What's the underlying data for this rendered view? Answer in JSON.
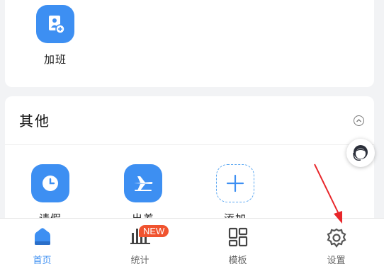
{
  "overtime": {
    "label": "加班"
  },
  "other_section": {
    "title": "其他",
    "items": [
      {
        "label": "请假",
        "icon": "clock-icon"
      },
      {
        "label": "出差",
        "icon": "airplane-icon"
      },
      {
        "label": "添加",
        "icon": "plus-icon"
      }
    ]
  },
  "tabbar": {
    "tabs": [
      {
        "label": "首页",
        "icon": "home-icon",
        "active": true
      },
      {
        "label": "统计",
        "icon": "bar-chart-icon",
        "badge": "NEW"
      },
      {
        "label": "模板",
        "icon": "grid-icon"
      },
      {
        "label": "设置",
        "icon": "gear-icon"
      }
    ]
  },
  "colors": {
    "accent": "#3d8ff2",
    "badge": "#f0532f",
    "arrow": "#e8262a"
  }
}
